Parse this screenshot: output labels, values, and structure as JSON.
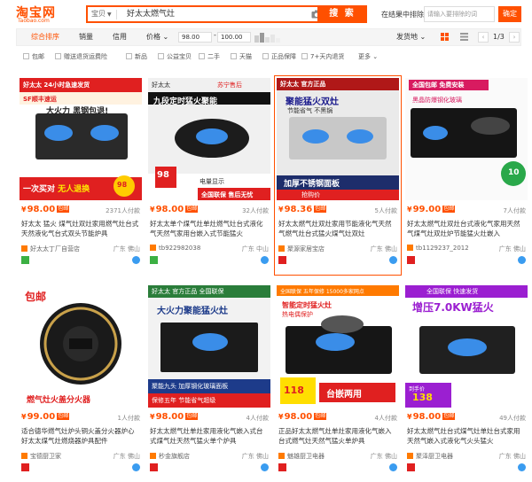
{
  "header": {
    "logo_cn": "淘宝网",
    "logo_en": "Taobao.com",
    "search_type": "宝贝",
    "search_query": "好太太燃气灶",
    "search_button": "搜 索",
    "exclude_label": "在结果中排除",
    "exclude_placeholder": "请输入要排除的词",
    "exclude_button": "确定"
  },
  "sortbar": {
    "default": "综合排序",
    "sales": "销量",
    "credit": "信用",
    "price": "价格",
    "price_min": "98.00",
    "price_max": "100.00",
    "ship": "发货地",
    "page": "1/3"
  },
  "filters": [
    "包邮",
    "赠送退货运费险",
    "新品",
    "公益宝贝",
    "二手",
    "天猫",
    "正品保障",
    "7+天内退货"
  ],
  "filters_more": "更多",
  "colors": {
    "accent": "#ff5000"
  },
  "products": [
    {
      "price": "98.00",
      "baoyou": "包邮",
      "sales": "2371人付款",
      "title": "好太太 猛火 煤气灶双灶家用燃气灶台式天然液化气台式双头节能炉具",
      "shop": "好太太丁厂自营店",
      "loc": "广东 佛山",
      "banner_top": "好太太 24小时急速发货",
      "badge": "SF顺丰速运",
      "tagline": "大火力 黑钢包退!",
      "footer1": "一次买对",
      "footer2": "无人退换",
      "price_tag": "98"
    },
    {
      "price": "98.00",
      "baoyou": "包邮",
      "sales": "32人付款",
      "title": "好太太单个煤气灶单灶燃气灶台式液化气天然气家用台嵌入式节能猛火",
      "shop": "tb922982038",
      "loc": "广东 中山",
      "banner_top": "九段定时猛火聚能",
      "badge": "苏宁售后",
      "tagline": "好太太",
      "footer1": "电量显示",
      "footer2": "全国联保 售后无忧",
      "price_tag": "98"
    },
    {
      "price": "98.36",
      "baoyou": "包邮",
      "sales": "5人付款",
      "title": "好太太燃气灶双灶家用节能液化气天然气燃气灶台式猛火煤气灶双灶",
      "shop": "聚源家居宝店",
      "loc": "广东 佛山",
      "banner_top": "好太太 官方正品",
      "badge": "聚能猛火双灶",
      "tagline": "节能省气 不黑锅",
      "footer1": "加厚不锈钢面板",
      "footer2": "抢购价",
      "price_tag": ""
    },
    {
      "price": "99.00",
      "baoyou": "包邮",
      "sales": "7人付款",
      "title": "好太太燃气灶双灶台式液化气家用天然气煤气灶双灶炉节能猛火灶嵌入",
      "shop": "tb1129237_2012",
      "loc": "广东 佛山",
      "banner_top": "全国包邮 免费安装",
      "badge": "黑晶防爆钢化玻璃",
      "tagline": "",
      "footer1": "",
      "footer2": "",
      "price_tag": "10"
    },
    {
      "price": "99.00",
      "baoyou": "包邮",
      "sales": "1人付款",
      "title": "适合德华燃气灶炉头铜火盖分火器炉心好太太煤气灶燃烧器炉具配件",
      "shop": "宝德厨卫家",
      "loc": "广东 佛山",
      "banner_top": "包邮",
      "badge": "",
      "tagline": "燃气灶火盖分火器",
      "footer1": "",
      "footer2": "",
      "price_tag": ""
    },
    {
      "price": "98.00",
      "baoyou": "包邮",
      "sales": "4人付款",
      "title": "好太太燃气灶单灶家用液化气嵌入式台式煤气灶天然气猛火单个炉具",
      "shop": "秒金旗舰店",
      "loc": "广东 佛山",
      "banner_top": "好太太 官方正品 全国联保",
      "badge": "大火力聚能猛火灶",
      "tagline": "",
      "footer1": "聚能九头 加厚钢化玻璃面板",
      "footer2": "保修五年 节能省气超级",
      "price_tag": ""
    },
    {
      "price": "98.00",
      "baoyou": "包邮",
      "sales": "4人付款",
      "title": "正品好太太燃气灶单灶家用液化气嵌入台式燃气灶天然气猛火单炉具",
      "shop": "魅雄厨卫电器",
      "loc": "广东 佛山",
      "banner_top": "全国联保 五年保修 15000多家网点",
      "badge": "智能定时猛火灶",
      "tagline": "热电偶保护",
      "footer1": "台嵌两用",
      "footer2": "118",
      "price_tag": "118"
    },
    {
      "price": "98.00",
      "baoyou": "包邮",
      "sales": "49人付款",
      "title": "好太太燃气灶台式煤气灶单灶台式家用天然气嵌入式液化气火头猛火",
      "shop": "聚泽厨卫电器",
      "loc": "广东 佛山",
      "banner_top": "全国联保 快速发货",
      "badge": "增压7.0KW猛火",
      "tagline": "",
      "footer1": "",
      "footer2": "到手价",
      "price_tag": "138"
    }
  ]
}
